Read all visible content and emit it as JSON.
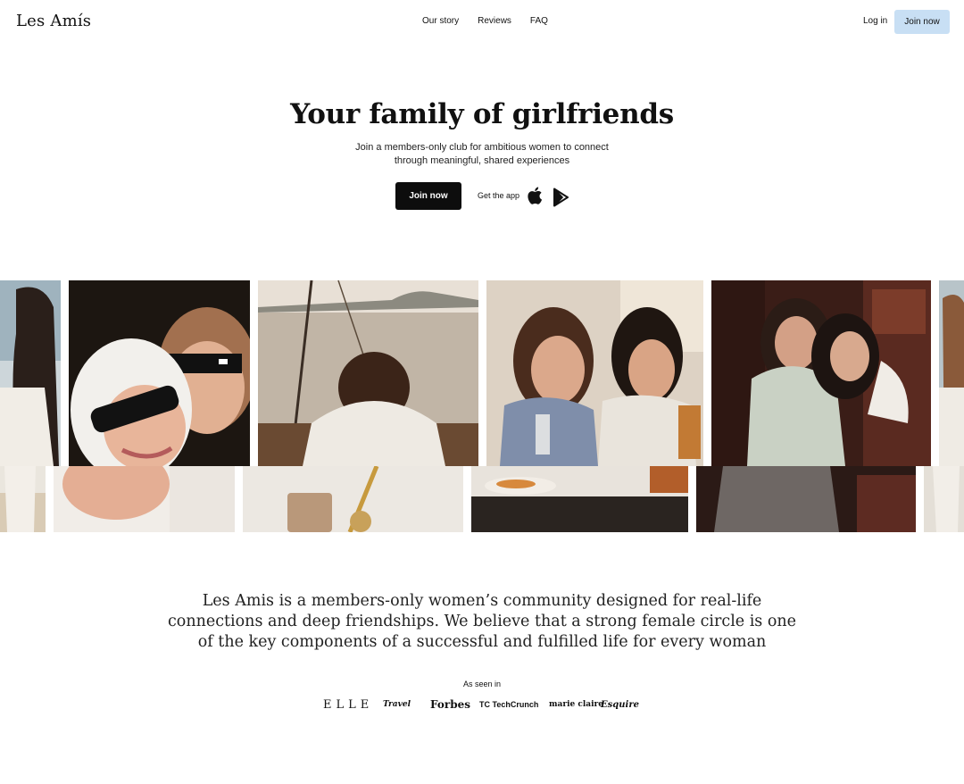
{
  "header": {
    "logo": "Les Amís",
    "nav": [
      "Our story",
      "Reviews",
      "FAQ"
    ],
    "login": "Log in",
    "join": "Join now"
  },
  "hero": {
    "title": "Your family of girlfriends",
    "subtitle_lines": [
      "Join a members-only club for ambitious women to connect",
      "through meaningful, shared experiences"
    ],
    "join": "Join now",
    "get_app": "Get the app",
    "apps": [
      "apple-icon",
      "google-play-icon"
    ]
  },
  "gallery": {
    "photos": [
      "beach-photo",
      "friends-sunglasses-photo",
      "sailboat-photo",
      "dinner-photo",
      "hug-photo",
      "beach-photo-right"
    ]
  },
  "about": {
    "lines": [
      "Les Amis is a members-only women’s community designed for real-life",
      "connections and deep friendships. We believe that a strong female circle is one",
      "of the key components of a successful and fulfilled life for every woman"
    ]
  },
  "press": {
    "label": "As seen in",
    "logos": [
      "ELLE",
      "Travel",
      "Forbes",
      "TechCrunch",
      "marie claire",
      "Esquire"
    ]
  },
  "colors": {
    "accent": "#c8dff4",
    "primary_button": "#0d0d0d"
  }
}
